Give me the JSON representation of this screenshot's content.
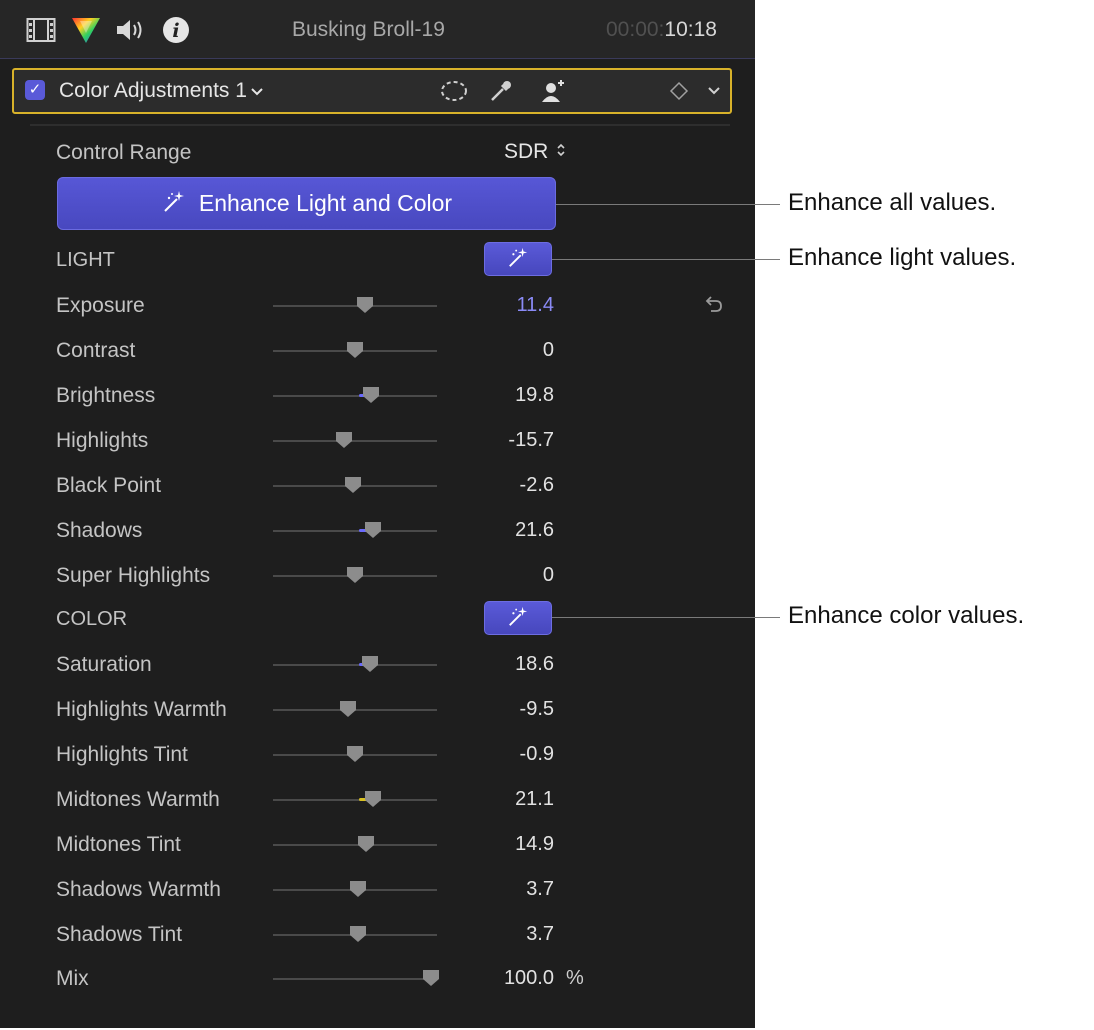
{
  "header": {
    "clip_title": "Busking Broll-19",
    "timecode_dim": "00:00:",
    "timecode_bright": "10:18",
    "icons": [
      "film-icon",
      "color-inspector-icon",
      "audio-icon",
      "info-icon"
    ]
  },
  "effect": {
    "name": "Color Adjustments 1",
    "enabled": true,
    "icons": [
      "mask-icon",
      "eyedropper-icon",
      "face-detect-icon",
      "keyframe-icon",
      "chevron-down-icon"
    ]
  },
  "control_range": {
    "label": "Control Range",
    "value": "SDR"
  },
  "enhance_all": {
    "label": "Enhance Light and Color"
  },
  "sections": {
    "light": "LIGHT",
    "color": "COLOR"
  },
  "light_params": [
    {
      "label": "Exposure",
      "value": "11.4",
      "level": 0.56,
      "accent": "#6a6aff",
      "highlight": true
    },
    {
      "label": "Contrast",
      "value": "0",
      "level": 0.5,
      "accent": ""
    },
    {
      "label": "Brightness",
      "value": "19.8",
      "level": 0.6,
      "accent": "#6a6aff"
    },
    {
      "label": "Highlights",
      "value": "-15.7",
      "level": 0.43,
      "accent": "#6a6aff"
    },
    {
      "label": "Black Point",
      "value": "-2.6",
      "level": 0.49,
      "accent": ""
    },
    {
      "label": "Shadows",
      "value": "21.6",
      "level": 0.61,
      "accent": "#6a6aff"
    },
    {
      "label": "Super Highlights",
      "value": "0",
      "level": 0.5,
      "accent": ""
    }
  ],
  "color_params": [
    {
      "label": "Saturation",
      "value": "18.6",
      "level": 0.59,
      "accent": "#6a6aff"
    },
    {
      "label": "Highlights Warmth",
      "value": "-9.5",
      "level": 0.46,
      "accent": ""
    },
    {
      "label": "Highlights Tint",
      "value": "-0.9",
      "level": 0.5,
      "accent": ""
    },
    {
      "label": "Midtones Warmth",
      "value": "21.1",
      "level": 0.61,
      "accent": "#d8c020"
    },
    {
      "label": "Midtones Tint",
      "value": "14.9",
      "level": 0.57,
      "accent": "#c040c0"
    },
    {
      "label": "Shadows Warmth",
      "value": "3.7",
      "level": 0.52,
      "accent": ""
    },
    {
      "label": "Shadows Tint",
      "value": "3.7",
      "level": 0.52,
      "accent": ""
    }
  ],
  "mix": {
    "label": "Mix",
    "value": "100.0",
    "unit": "%",
    "level": 1.0
  },
  "callouts": {
    "all": "Enhance all values.",
    "light": "Enhance light values.",
    "color": "Enhance color values."
  },
  "colors": {
    "accent": "#5252cc",
    "panel": "#1e1e1e",
    "focus_border": "#d8b22a"
  }
}
